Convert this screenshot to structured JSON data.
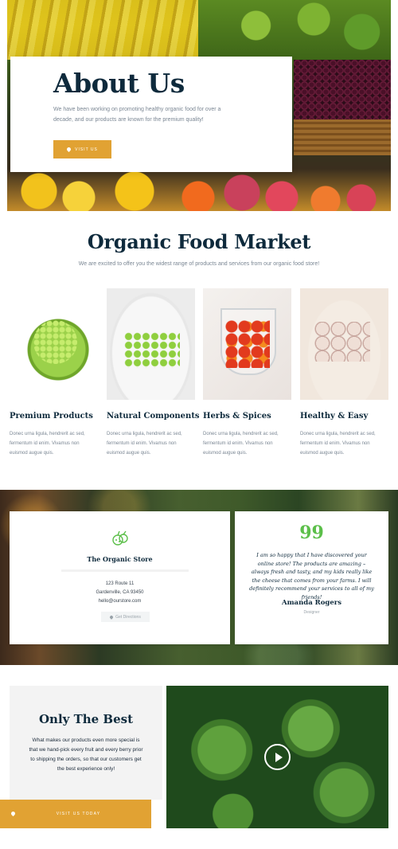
{
  "hero": {
    "title": "About Us",
    "text": "We have been working on promoting healthy organic food for over a decade, and our products are known for the premium quality!",
    "button_label": "VISIT US"
  },
  "market": {
    "title": "Organic Food Market",
    "subtitle": "We are excited to offer you the widest range of products and services from our organic food store!"
  },
  "features": [
    {
      "title": "Premium Products",
      "text": "Donec urna ligula, hendrerit ac sed, fermentum id enim. Vivamus non euismod augue quis."
    },
    {
      "title": "Natural Components",
      "text": "Donec urna ligula, hendrerit ac sed, fermentum id enim. Vivamus non euismod augue quis."
    },
    {
      "title": "Herbs & Spices",
      "text": "Donec urna ligula, hendrerit ac sed, fermentum id enim. Vivamus non euismod augue quis."
    },
    {
      "title": "Healthy & Easy",
      "text": "Donec urna ligula, hendrerit ac sed, fermentum id enim. Vivamus non euismod augue quis."
    }
  ],
  "store": {
    "icon": "vegetables-icon",
    "name": "The Organic Store",
    "address_line1": "123 Route 11",
    "address_line2": "Gardenville, CA 93450",
    "email": "hello@ourstore.com",
    "directions_label": "Get Directions"
  },
  "testimonial": {
    "icon": "quote-icon",
    "quote_mark": "99",
    "text": "I am so happy that I have discovered your online store! The products are amazing – always fresh and tasty, and my kids really like the cheese that comes from your farms. I will definitely recommend your services to all of my friends!",
    "name": "Amanda Rogers",
    "role": "Designer"
  },
  "best": {
    "title": "Only The Best",
    "text": "What makes our products even more special is that we hand-pick every fruit and every berry prior to shipping the orders, so that our customers get the best experience only!",
    "button_label": "VISIT US TODAY"
  },
  "video": {
    "icon": "play-icon"
  },
  "colors": {
    "accent": "#e1a233",
    "heading": "#0e2a3c",
    "green": "#5cbf4a"
  }
}
